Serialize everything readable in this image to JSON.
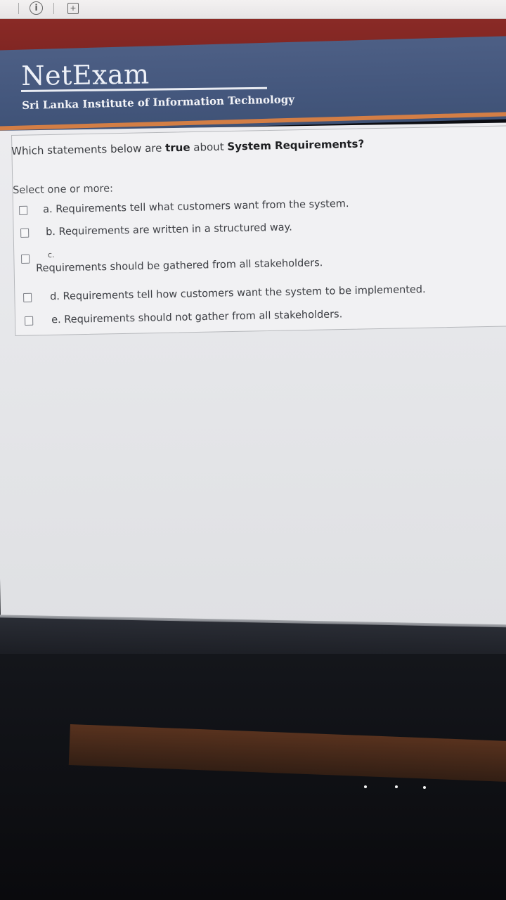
{
  "toolbar": {
    "icons": [
      "info-icon",
      "add-bookmark-icon"
    ],
    "info_glyph": "i",
    "plus_glyph": "+"
  },
  "header": {
    "logo": "NetExam",
    "institute": "Sri Lanka Institute of Information Technology"
  },
  "question": {
    "prefix": "Which statements below are ",
    "emphasis_true": "true",
    "middle": " about ",
    "emphasis_topic": "System Requirements?",
    "select_label": "Select one or more:",
    "options": [
      {
        "label": "a. Requirements tell what customers want from the system.",
        "checked": false
      },
      {
        "label": "b. Requirements are written in a structured way.",
        "checked": false
      },
      {
        "letter": "c.",
        "label": "Requirements should be gathered from all stakeholders.",
        "checked": false
      },
      {
        "label": "d. Requirements tell how customers want the system to be implemented.",
        "checked": false
      },
      {
        "label": "e. Requirements should not gather from all stakeholders.",
        "checked": false
      }
    ]
  },
  "colors": {
    "header_blue": "#4d5f85",
    "accent_orange": "#d37e45",
    "top_red": "#8a2a26"
  }
}
